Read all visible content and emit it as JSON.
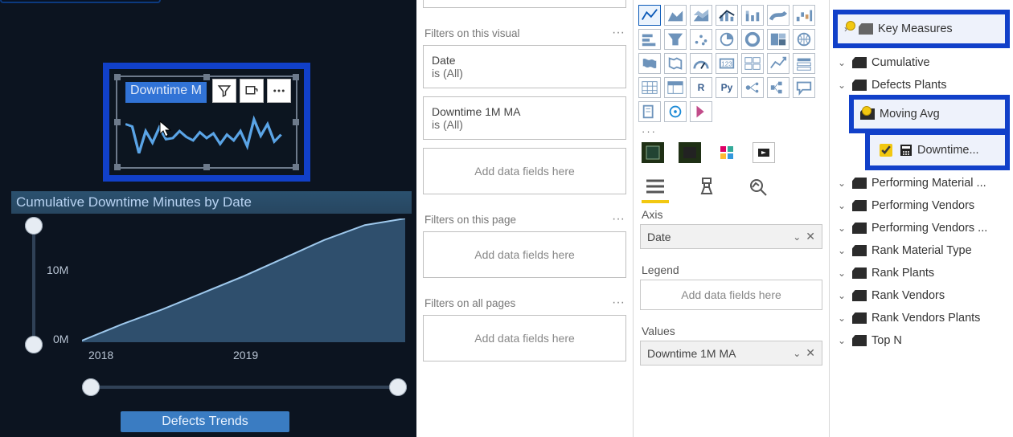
{
  "canvas": {
    "selected_visual_title": "Downtime M",
    "cumulative_title": "Cumulative Downtime Minutes by Date",
    "y_ticks": [
      "10M",
      "0M"
    ],
    "x_ticks": [
      "2018",
      "2019"
    ],
    "defects_button": "Defects Trends"
  },
  "filters": {
    "section_visual": "Filters on this visual",
    "date_field": "Date",
    "date_value": "is (All)",
    "downtime_field": "Downtime 1M MA",
    "downtime_value": "is (All)",
    "add_fields": "Add data fields here",
    "section_page": "Filters on this page",
    "section_all": "Filters on all pages"
  },
  "viz": {
    "axis_label": "Axis",
    "axis_value": "Date",
    "legend_label": "Legend",
    "legend_placeholder": "Add data fields here",
    "values_label": "Values",
    "values_value": "Downtime 1M MA"
  },
  "fields": {
    "key_measures": "Key Measures",
    "cumulative": "Cumulative",
    "defects_plants": "Defects Plants",
    "moving_avg": "Moving Avg",
    "downtime": "Downtime...",
    "performing_material": "Performing Material ...",
    "performing_vendors": "Performing Vendors",
    "performing_vendors2": "Performing Vendors ...",
    "rank_material_type": "Rank Material Type",
    "rank_plants": "Rank Plants",
    "rank_vendors": "Rank Vendors",
    "rank_vendors_plants": "Rank Vendors Plants",
    "top_n": "Top N"
  },
  "chart_data": [
    {
      "type": "line",
      "title": "Downtime M",
      "x": [
        0,
        1,
        2,
        3,
        4,
        5,
        6,
        7,
        8,
        9,
        10,
        11,
        12,
        13,
        14,
        15,
        16,
        17,
        18,
        19,
        20,
        21,
        22,
        23
      ],
      "values": [
        70,
        66,
        30,
        55,
        40,
        62,
        48,
        50,
        60,
        52,
        47,
        58,
        50,
        56,
        44,
        54,
        48,
        60,
        40,
        80,
        55,
        72,
        48,
        54
      ],
      "ylim": [
        0,
        100
      ],
      "xlabel": "",
      "ylabel": ""
    },
    {
      "type": "area",
      "title": "Cumulative Downtime Minutes by Date",
      "x": [
        "2018-01",
        "2018-04",
        "2018-07",
        "2018-10",
        "2019-01",
        "2019-04",
        "2019-07",
        "2019-10"
      ],
      "values": [
        0,
        2000000,
        4000000,
        6000000,
        8000000,
        10000000,
        12000000,
        13500000
      ],
      "ylim": [
        0,
        14000000
      ],
      "y_ticks": [
        0,
        10000000
      ],
      "y_tick_labels": [
        "0M",
        "10M"
      ],
      "xlabel": "",
      "ylabel": ""
    }
  ]
}
